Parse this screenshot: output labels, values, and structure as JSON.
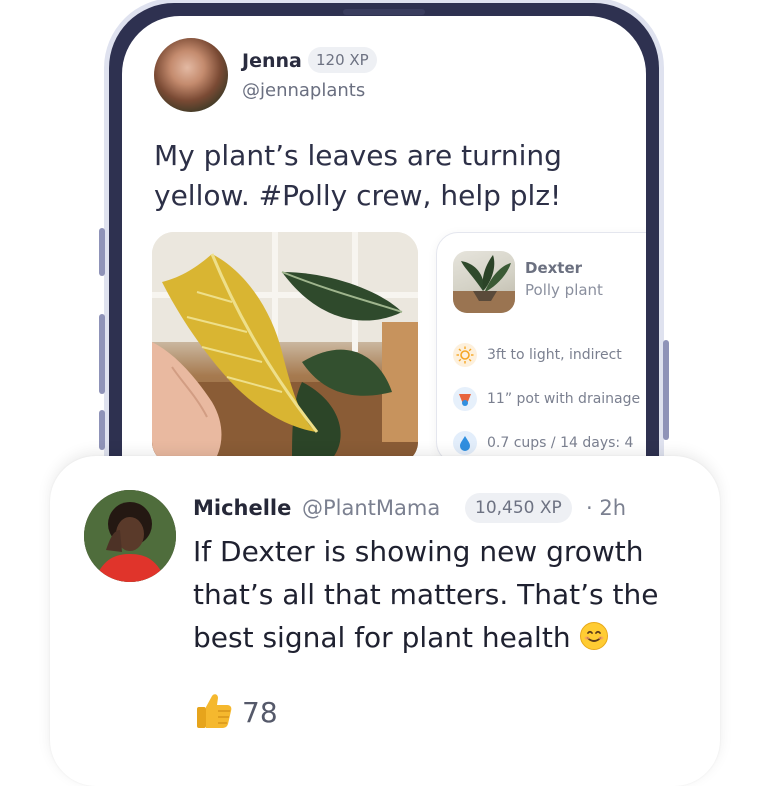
{
  "post": {
    "author_name": "Jenna",
    "author_xp": "120 XP",
    "author_handle": "@jennaplants",
    "text": "My plant’s leaves are turning yellow. #Polly crew, help plz!"
  },
  "plant_card": {
    "name": "Dexter",
    "type": "Polly plant",
    "care": [
      {
        "icon": "sun-icon",
        "text": "3ft to light, indirect",
        "color": "#f5a623"
      },
      {
        "icon": "pot-icon",
        "text": "11” pot with drainage",
        "color": "#e8643c"
      },
      {
        "icon": "water-drop-icon",
        "text": "0.7 cups / 14 days: 4",
        "color": "#2f8fe0"
      }
    ]
  },
  "comment": {
    "author_name": "Michelle",
    "author_handle": "@PlantMama",
    "author_xp": "10,450 XP",
    "time": "· 2h",
    "text": "If Dexter is showing new growth that’s all that matters. That’s the best signal for plant health",
    "emoji": "smiling-face-emoji",
    "likes": "78"
  },
  "colors": {
    "phone_frame": "#2e3150",
    "accent_sun": "#f5a623",
    "accent_water": "#2f8fe0"
  }
}
